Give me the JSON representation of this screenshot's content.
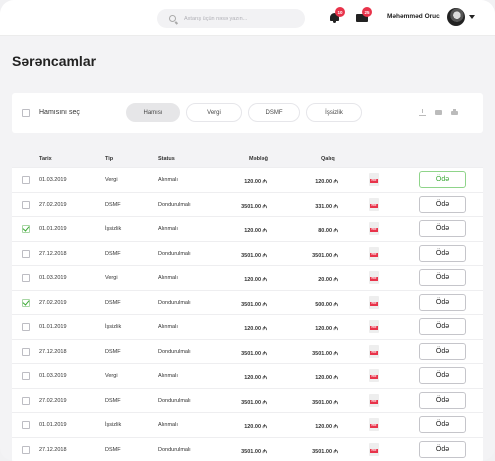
{
  "header": {
    "search_placeholder": "Axtarış üçün nəsə yazın...",
    "notifications_count": "10",
    "messages_count": "25",
    "user_name": "Məhəmməd Oruc"
  },
  "page": {
    "title": "Sərəncamlar"
  },
  "filter": {
    "select_all_label": "Hamısını seç",
    "tabs": [
      "Hamısı",
      "Vergi",
      "DSMF",
      "İşsizlik"
    ],
    "active_tab": "Hamısı"
  },
  "table": {
    "columns": [
      "Tarix",
      "Tip",
      "Status",
      "Məbləğ",
      "Qalıq"
    ],
    "pay_label": "Ödə",
    "pdf_label": "PDF",
    "rows": [
      {
        "date": "01.03.2019",
        "type": "Vergi",
        "status": "Alınmalı",
        "amount": "120.00 ₼",
        "balance": "120.00 ₼",
        "checked": false,
        "highlight": true
      },
      {
        "date": "27.02.2019",
        "type": "DSMF",
        "status": "Dondurulmalı",
        "amount": "3501.00 ₼",
        "balance": "331.00 ₼",
        "checked": false,
        "highlight": false
      },
      {
        "date": "01.01.2019",
        "type": "İşsizlik",
        "status": "Alınmalı",
        "amount": "120.00 ₼",
        "balance": "80.00 ₼",
        "checked": true,
        "highlight": false
      },
      {
        "date": "27.12.2018",
        "type": "DSMF",
        "status": "Dondurulmalı",
        "amount": "3501.00 ₼",
        "balance": "3501.00 ₼",
        "checked": false,
        "highlight": false
      },
      {
        "date": "01.03.2019",
        "type": "Vergi",
        "status": "Alınmalı",
        "amount": "120.00 ₼",
        "balance": "20.00 ₼",
        "checked": false,
        "highlight": false
      },
      {
        "date": "27.02.2019",
        "type": "DSMF",
        "status": "Dondurulmalı",
        "amount": "3501.00 ₼",
        "balance": "500.00 ₼",
        "checked": true,
        "highlight": false
      },
      {
        "date": "01.01.2019",
        "type": "İşsizlik",
        "status": "Alınmalı",
        "amount": "120.00 ₼",
        "balance": "120.00 ₼",
        "checked": false,
        "highlight": false
      },
      {
        "date": "27.12.2018",
        "type": "DSMF",
        "status": "Dondurulmalı",
        "amount": "3501.00 ₼",
        "balance": "3501.00 ₼",
        "checked": false,
        "highlight": false
      },
      {
        "date": "01.03.2019",
        "type": "Vergi",
        "status": "Alınmalı",
        "amount": "120.00 ₼",
        "balance": "120.00 ₼",
        "checked": false,
        "highlight": false
      },
      {
        "date": "27.02.2019",
        "type": "DSMF",
        "status": "Dondurulmalı",
        "amount": "3501.00 ₼",
        "balance": "3501.00 ₼",
        "checked": false,
        "highlight": false
      },
      {
        "date": "01.01.2019",
        "type": "İşsizlik",
        "status": "Alınmalı",
        "amount": "120.00 ₼",
        "balance": "120.00 ₼",
        "checked": false,
        "highlight": false
      },
      {
        "date": "27.12.2018",
        "type": "DSMF",
        "status": "Dondurulmalı",
        "amount": "3501.00 ₼",
        "balance": "3501.00 ₼",
        "checked": false,
        "highlight": false
      }
    ]
  }
}
